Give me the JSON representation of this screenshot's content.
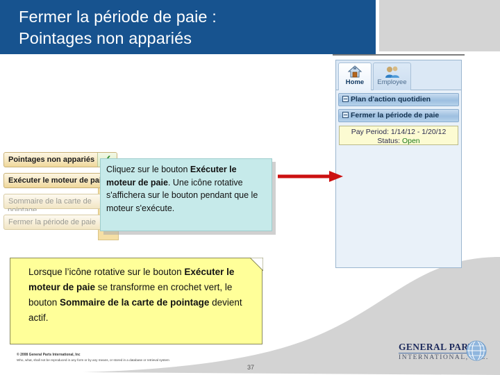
{
  "slide": {
    "title_line1": "Fermer la période de paie :",
    "title_line2": "Pointages non appariés",
    "page_number": "37"
  },
  "app_panel": {
    "tabs": [
      {
        "label": "Home",
        "icon": "home-icon",
        "active": true
      },
      {
        "label": "Employee",
        "icon": "employee-icon",
        "active": false
      }
    ],
    "section_bars": [
      {
        "label": "Plan d'action quotidien",
        "icon": "collapse-box-icon"
      },
      {
        "label": "Fermer la période de paie",
        "icon": "collapse-box-icon"
      }
    ],
    "pay_period": {
      "period_label": "Pay Period: 1/14/12 - 1/20/12",
      "status_prefix": "Status: ",
      "status_value": "Open",
      "status_color": "#1d7a1d"
    },
    "action_buttons": [
      {
        "label": "Pointages non appariés",
        "state": "complete",
        "check": "✓"
      },
      {
        "label": "Exécuter le moteur de paie",
        "state": "enabled"
      },
      {
        "label": "Sommaire de la carte de",
        "label_line2": "pointage",
        "state": "disabled"
      },
      {
        "label": "Fermer la période de paie",
        "state": "disabled"
      }
    ]
  },
  "callouts": {
    "cyan": {
      "part1": "Cliquez sur le bouton ",
      "bold1": "Exécuter le moteur de paie",
      "part2": ". Une icône rotative s'affichera sur le bouton pendant que le moteur s'exécute."
    },
    "yellow": {
      "part1": "Lorsque l’icône rotative sur le bouton ",
      "bold1": "Exécuter le moteur de paie",
      "part2": " se transforme en crochet vert, le bouton ",
      "bold2": "Sommaire de la carte de pointage",
      "part3": " devient actif."
    }
  },
  "footer": {
    "copyright": "© 2008 General Parts International, Inc",
    "confidential": "Who, what, shall not be reproduced in any form or by any means, or stored in a database or retrieval system",
    "logo_line1": "GENERAL PARTS",
    "logo_line2": "INTERNATIONAL, INC."
  },
  "colors": {
    "title_blue": "#17538f",
    "arrow_red": "#cc1111",
    "cyan_callout": "#c6eaea",
    "yellow_callout": "#ffff99"
  }
}
